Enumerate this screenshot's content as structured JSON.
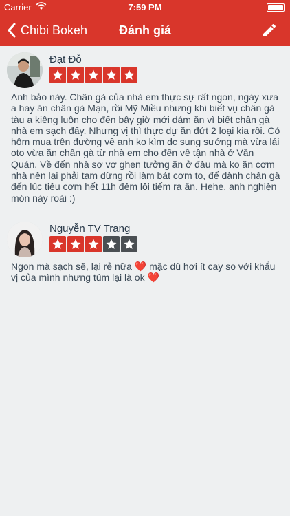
{
  "status_bar": {
    "carrier": "Carrier",
    "time": "7:59 PM"
  },
  "nav": {
    "back_label": "Chibi Bokeh",
    "title": "Đánh giá"
  },
  "colors": {
    "accent": "#d9362b",
    "star_off": "#4a4f53",
    "text": "#3c4a57"
  },
  "reviews": [
    {
      "name": "Đạt Đỗ",
      "rating": 5,
      "text": "Anh bảo này. Chân gà của nhà em thực sự rất ngon, ngày xưa a hay ăn chân gà Mạn, rồi Mỹ Miều nhưng khi biết vụ chân gà tàu a kiêng luôn cho đến bây giờ mới dám ăn vì biết chân gà nhà em sạch đấy. Nhưng vị thì thực dự ăn đứt 2 loại kia rồi. Có hôm mua trên đường về anh ko kìm dc sung sướng mà vừa lái oto vừa ăn chân gà từ nhà em cho đến về tận nhà ở Văn Quán. Về đến nhà sợ vợ ghen tưởng ăn ở đâu mà ko ăn cơm nhà nên lại phải tạm dừng rồi làm bát cơm to, để dành chân gà đến lúc tiêu cơm hết 11h đêm lôi tiếm ra ăn. Hehe, anh nghiện món này roài :)"
    },
    {
      "name": "Nguyễn TV Trang",
      "rating": 3,
      "text_parts": [
        "Ngon mà sạch sẽ, lại rẻ nữa ",
        " mặc dù hơi ít cay so với khẩu vị của mình nhưng túm lại là ok "
      ],
      "emoji": "❤️"
    }
  ]
}
